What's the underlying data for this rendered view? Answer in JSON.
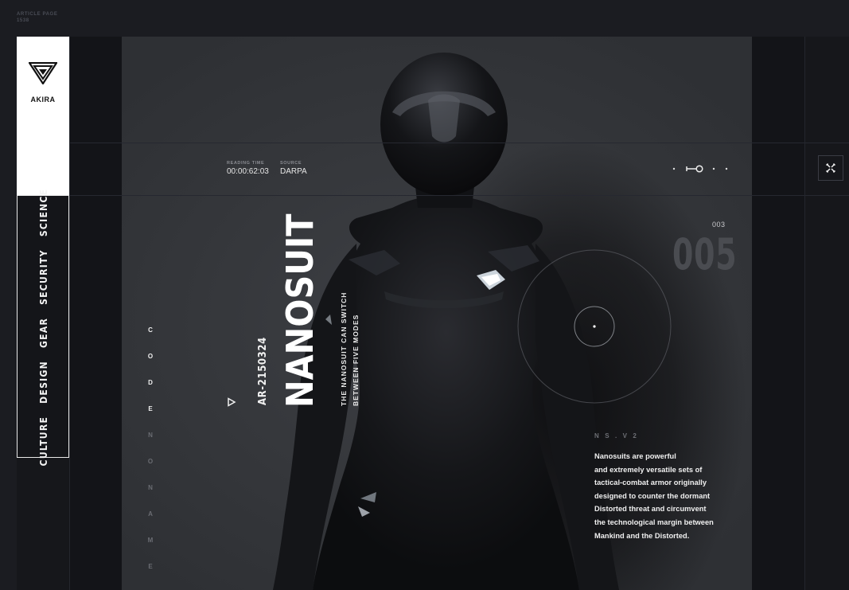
{
  "page_caption": {
    "line1": "ARTICLE PAGE",
    "line2": "1538"
  },
  "brand": {
    "name": "AKIRA",
    "logo": "inverted-triangle-logo"
  },
  "nav": {
    "items": [
      "CULTURE",
      "DESIGN",
      "GEAR",
      "SECURITY",
      "SCIENCE"
    ]
  },
  "meta": {
    "reading_time_label": "READING TIME",
    "reading_time_value": "00:00:62:03",
    "source_label": "SOURCE",
    "source_value": "DARPA"
  },
  "close_icon": "close-x-icon",
  "counter": {
    "small": "003",
    "big": "005"
  },
  "codename": {
    "letters": [
      "C",
      "O",
      "D",
      "E",
      "N",
      "O",
      "N",
      "A",
      "M",
      "E"
    ],
    "highlighted_count": 4
  },
  "article": {
    "code": "AR-2150324",
    "title": "NANOSUIT",
    "subtitle_line1": "THE NANOSUIT CAN SWITCH",
    "subtitle_line2": "BETWEEN FIVE MODES",
    "body_label": "N S . V 2",
    "body_lines": [
      "Nanosuits are powerful",
      "and extremely versatile sets of",
      "tactical-combat armor originally",
      "designed to counter the dormant",
      "Distorted threat and circumvent",
      "the technological margin between",
      "Mankind and the Distorted."
    ]
  },
  "colors": {
    "background": "#1b1c21",
    "panel": "#16171b",
    "accent": "#ffffff",
    "muted": "#4a4c51"
  }
}
